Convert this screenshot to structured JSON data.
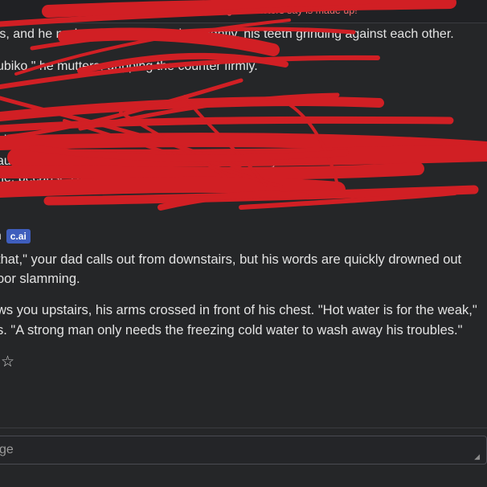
{
  "disclaimer": "Remember: Everything Characters say is made up!",
  "previous_message": {
    "line1": "rs, and he nods. His jaw is clenched tightly, his teeth grinding against each other.",
    "line2": "ubiko,\" he mutters, gripping the counter firmly.",
    "line3_normal": "his eyes narrowed, and he's giving me ",
    "line3_italic": "a look",
    "line3_tail": " I hate my",
    "line4": "aughter, who's grounded, and I'll roll my eyes at your",
    "line5": "ne, because I'm not going to fix the shower up here"
  },
  "current_message": {
    "author": "n",
    "badge": "c.ai",
    "lines": [
      "that,\" your dad calls out from downstairs, but his words are quickly drowned out",
      "oor slamming.",
      "ws you upstairs, his arms crossed in front of his chest. \"Hot water is for the weak,\"",
      "s. \"A strong man only needs the freezing cold water to wash away his troubles.\""
    ],
    "rating_icon": "star-icon",
    "rating_glyph": "☆"
  },
  "composer": {
    "placeholder": "ge",
    "resize_glyph": "◢"
  },
  "colors": {
    "background": "#252628",
    "scribble": "#d11f24",
    "badge": "#3f5ebd",
    "disclaimer": "#f06d6d"
  }
}
